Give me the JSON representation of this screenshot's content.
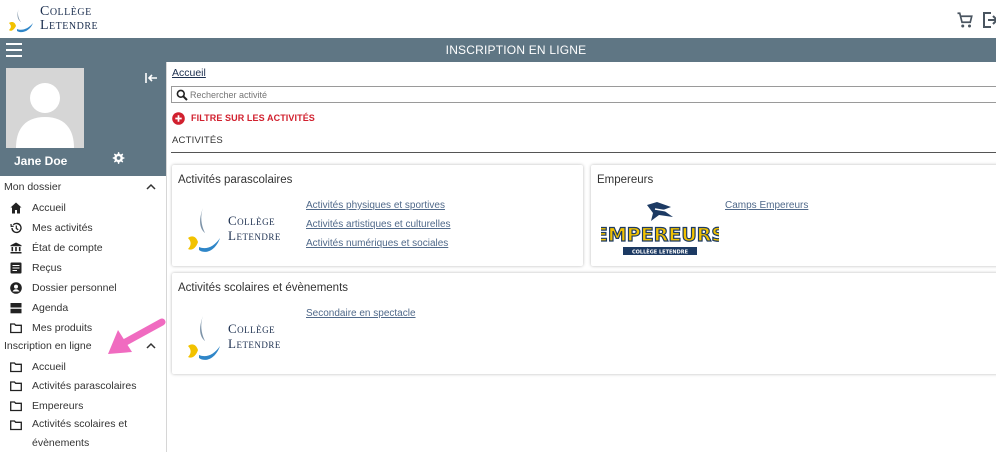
{
  "brand": {
    "line1": "Collège",
    "line2": "Letendre"
  },
  "header": {
    "title": "INSCRIPTION EN LIGNE"
  },
  "profile": {
    "name": "Jane Doe"
  },
  "sidebar": {
    "mon_dossier": {
      "label": "Mon dossier",
      "items": [
        {
          "label": "Accueil",
          "icon": "home-icon"
        },
        {
          "label": "Mes activités",
          "icon": "history-icon"
        },
        {
          "label": "État de compte",
          "icon": "bank-icon"
        },
        {
          "label": "Reçus",
          "icon": "receipt-icon"
        },
        {
          "label": "Dossier personnel",
          "icon": "account-circle-icon"
        },
        {
          "label": "Agenda",
          "icon": "agenda-icon"
        },
        {
          "label": "Mes produits",
          "icon": "folder-icon"
        }
      ]
    },
    "inscription": {
      "label": "Inscription en ligne",
      "items": [
        {
          "label": "Accueil",
          "icon": "folder-icon"
        },
        {
          "label": "Activités parascolaires",
          "icon": "folder-icon"
        },
        {
          "label": "Empereurs",
          "icon": "folder-icon"
        },
        {
          "label": "Activités scolaires et évènements",
          "icon": "folder-icon"
        }
      ]
    }
  },
  "main": {
    "breadcrumb": "Accueil",
    "search": {
      "placeholder": "Rechercher activité",
      "clear": ">"
    },
    "filter_label": "FILTRE SUR LES ACTIVITÉS",
    "activities_heading": "ACTIVITÉS",
    "cards": {
      "parascolaires": {
        "title": "Activités parascolaires",
        "links": [
          "Activités physiques et sportives",
          "Activités artistiques et culturelles",
          "Activités numériques et sociales"
        ]
      },
      "empereurs": {
        "title": "Empereurs",
        "links": [
          "Camps Empereurs"
        ],
        "logo_word": "EMPEREURS",
        "logo_sub": "COLLÈGE LETENDRE"
      },
      "scolaires": {
        "title": "Activités scolaires et évènements",
        "links": [
          "Secondaire en spectacle"
        ]
      }
    }
  },
  "colors": {
    "header_bg": "#5f7684",
    "navy": "#1c2f4f",
    "accent_red": "#d1202e",
    "link": "#50698a",
    "annotation_pink": "#f06bc0",
    "logo_yellow": "#f2c200",
    "logo_blue": "#2f86c8"
  }
}
